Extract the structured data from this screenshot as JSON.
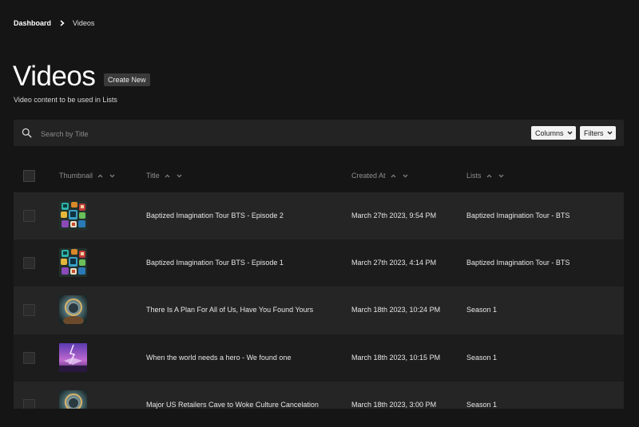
{
  "breadcrumb": {
    "parent": "Dashboard",
    "current": "Videos"
  },
  "header": {
    "title": "Videos",
    "create_label": "Create New",
    "subtitle": "Video content to be used in Lists"
  },
  "search": {
    "placeholder": "Search by Title",
    "value": ""
  },
  "toolbar": {
    "columns_label": "Columns",
    "filters_label": "Filters"
  },
  "table": {
    "columns": [
      "Thumbnail",
      "Title",
      "Created At",
      "Lists"
    ],
    "rows": [
      {
        "thumbnail": "app-icons-grid",
        "title": "Baptized Imagination Tour BTS - Episode 2",
        "created": "March 27th 2023, 9:54 PM",
        "lists": "Baptized Imagination Tour - BTS"
      },
      {
        "thumbnail": "app-icons-grid",
        "title": "Baptized Imagination Tour BTS - Episode 1",
        "created": "March 27th 2023, 4:14 PM",
        "lists": "Baptized Imagination Tour - BTS"
      },
      {
        "thumbnail": "astronaut-portrait",
        "title": "There Is A Plan For All of Us, Have You Found Yours",
        "created": "March 18th 2023, 10:24 PM",
        "lists": "Season 1"
      },
      {
        "thumbnail": "purple-lightning",
        "title": "When the world needs a hero - We found one",
        "created": "March 18th 2023, 10:15 PM",
        "lists": "Season 1"
      },
      {
        "thumbnail": "astronaut-portrait",
        "title": "Major US Retailers Cave to Woke Culture Cancelation",
        "created": "March 18th 2023, 3:00 PM",
        "lists": "Season 1"
      }
    ]
  },
  "colors": {
    "background": "#151515",
    "panel": "#232323",
    "row_odd": "#252525",
    "row_even": "#1c1c1c",
    "button_light": "#f2f2f2",
    "muted_text": "#8f8f8f"
  },
  "icons": {
    "breadcrumb_separator": "chevron-right-icon",
    "search": "search-icon",
    "dropdown": "chevron-down-icon",
    "sort_asc": "sort-asc-icon",
    "sort_desc": "sort-desc-icon"
  }
}
